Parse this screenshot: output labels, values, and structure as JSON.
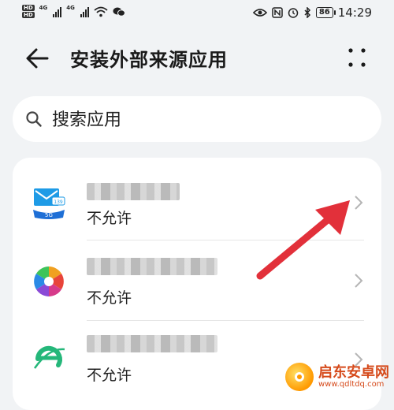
{
  "status_bar": {
    "hd1": "HD",
    "hd2": "HD",
    "net1": "4G",
    "net2": "4G",
    "battery": "86",
    "time": "14:29"
  },
  "header": {
    "title": "安装外部来源应用"
  },
  "search": {
    "placeholder": "搜索应用"
  },
  "apps": [
    {
      "status": "不允许",
      "icon": "mail-139-5g-icon"
    },
    {
      "status": "不允许",
      "icon": "pinwheel-browser-icon"
    },
    {
      "status": "不允许",
      "icon": "e-browser-icon"
    }
  ],
  "watermark": {
    "title": "启东安卓网",
    "url": "www.qdltdq.com"
  },
  "colors": {
    "background": "#f1f3f5",
    "card": "#ffffff",
    "annotation_arrow": "#e2303a",
    "watermark": "#d64b1c"
  }
}
